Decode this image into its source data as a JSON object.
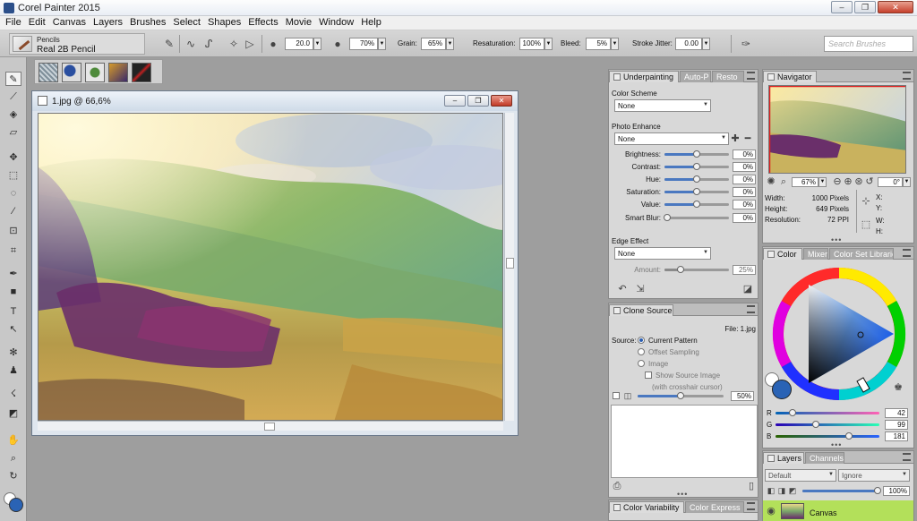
{
  "window": {
    "title": "Corel Painter 2015"
  },
  "menu": [
    "File",
    "Edit",
    "Canvas",
    "Layers",
    "Brushes",
    "Select",
    "Shapes",
    "Effects",
    "Movie",
    "Window",
    "Help"
  ],
  "brush": {
    "category": "Pencils",
    "variant": "Real 2B Pencil"
  },
  "property_bar": {
    "size": "20.0",
    "opacity": "70%",
    "grain_label": "Grain:",
    "grain": "65%",
    "resaturation_label": "Resaturation:",
    "resaturation": "100%",
    "bleed_label": "Bleed:",
    "bleed": "5%",
    "jitter_label": "Stroke Jitter:",
    "jitter": "0.00",
    "search_placeholder": "Search Brushes"
  },
  "document": {
    "title": "1.jpg @ 66,6%"
  },
  "underpainting": {
    "tabs": [
      "Underpainting",
      "Auto-P",
      "Resto"
    ],
    "color_scheme_label": "Color Scheme",
    "color_scheme": "None",
    "photo_enhance_label": "Photo Enhance",
    "photo_enhance": "None",
    "adjustments": [
      {
        "label": "Brightness:",
        "value": "0%",
        "pos": 0.5
      },
      {
        "label": "Contrast:",
        "value": "0%",
        "pos": 0.5
      },
      {
        "label": "Hue:",
        "value": "0%",
        "pos": 0.5
      },
      {
        "label": "Saturation:",
        "value": "0%",
        "pos": 0.5
      },
      {
        "label": "Value:",
        "value": "0%",
        "pos": 0.5
      },
      {
        "label": "Smart Blur:",
        "value": "0%",
        "pos": 0.0
      }
    ],
    "edge_effect_label": "Edge Effect",
    "edge_effect": "None",
    "amount_label": "Amount:",
    "amount": "25%",
    "amount_pos": 0.25
  },
  "clone_source": {
    "tab": "Clone Source",
    "file": "File: 1.jpg",
    "source_label": "Source:",
    "options": [
      "Current Pattern",
      "Offset Sampling",
      "Image"
    ],
    "selected": 0,
    "show_source": "Show Source Image",
    "crosshair": "(with crosshair cursor)",
    "opacity": "50%"
  },
  "bottom_tabs": [
    "Color Variability",
    "Color Express"
  ],
  "navigator": {
    "tab": "Navigator",
    "zoom": "67%",
    "rotation": "0°",
    "width_label": "Width:",
    "width": "1000 Pixels",
    "height_label": "Height:",
    "height": "649 Pixels",
    "res_label": "Resolution:",
    "resolution": "72 PPI",
    "x_label": "X:",
    "y_label": "Y:",
    "w_label": "W:",
    "h_label": "H:"
  },
  "color": {
    "tabs": [
      "Color",
      "Mixer",
      "Color Set Libraries"
    ],
    "r_label": "R",
    "r": "42",
    "g_label": "G",
    "g": "99",
    "b_label": "B",
    "b": "181",
    "main_color": "#2a63b5"
  },
  "layers": {
    "tabs": [
      "Layers",
      "Channels"
    ],
    "composite": "Default",
    "preserve": "Ignore",
    "opacity": "100%",
    "canvas_name": "Canvas"
  }
}
